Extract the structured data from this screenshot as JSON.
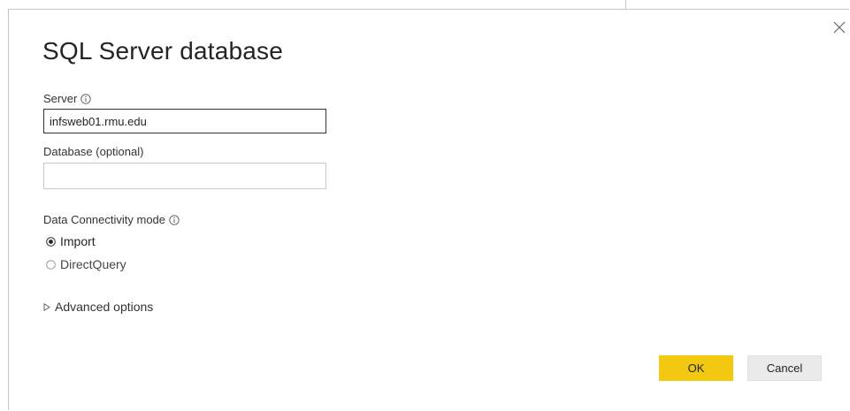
{
  "dialog": {
    "title": "SQL Server database",
    "close_icon": "close-icon"
  },
  "server": {
    "label": "Server",
    "info_icon": "info-icon",
    "value": "infsweb01.rmu.edu"
  },
  "database": {
    "label": "Database (optional)",
    "value": "",
    "placeholder": ""
  },
  "connectivity": {
    "label": "Data Connectivity mode",
    "info_icon": "info-icon",
    "options": [
      {
        "label": "Import",
        "selected": true
      },
      {
        "label": "DirectQuery",
        "selected": false
      }
    ]
  },
  "advanced": {
    "label": "Advanced options",
    "icon": "expand-triangle-icon"
  },
  "buttons": {
    "ok_label": "OK",
    "cancel_label": "Cancel"
  },
  "colors": {
    "accent": "#f2c811",
    "cancel_bg": "#eaeaea",
    "text": "#252423"
  }
}
